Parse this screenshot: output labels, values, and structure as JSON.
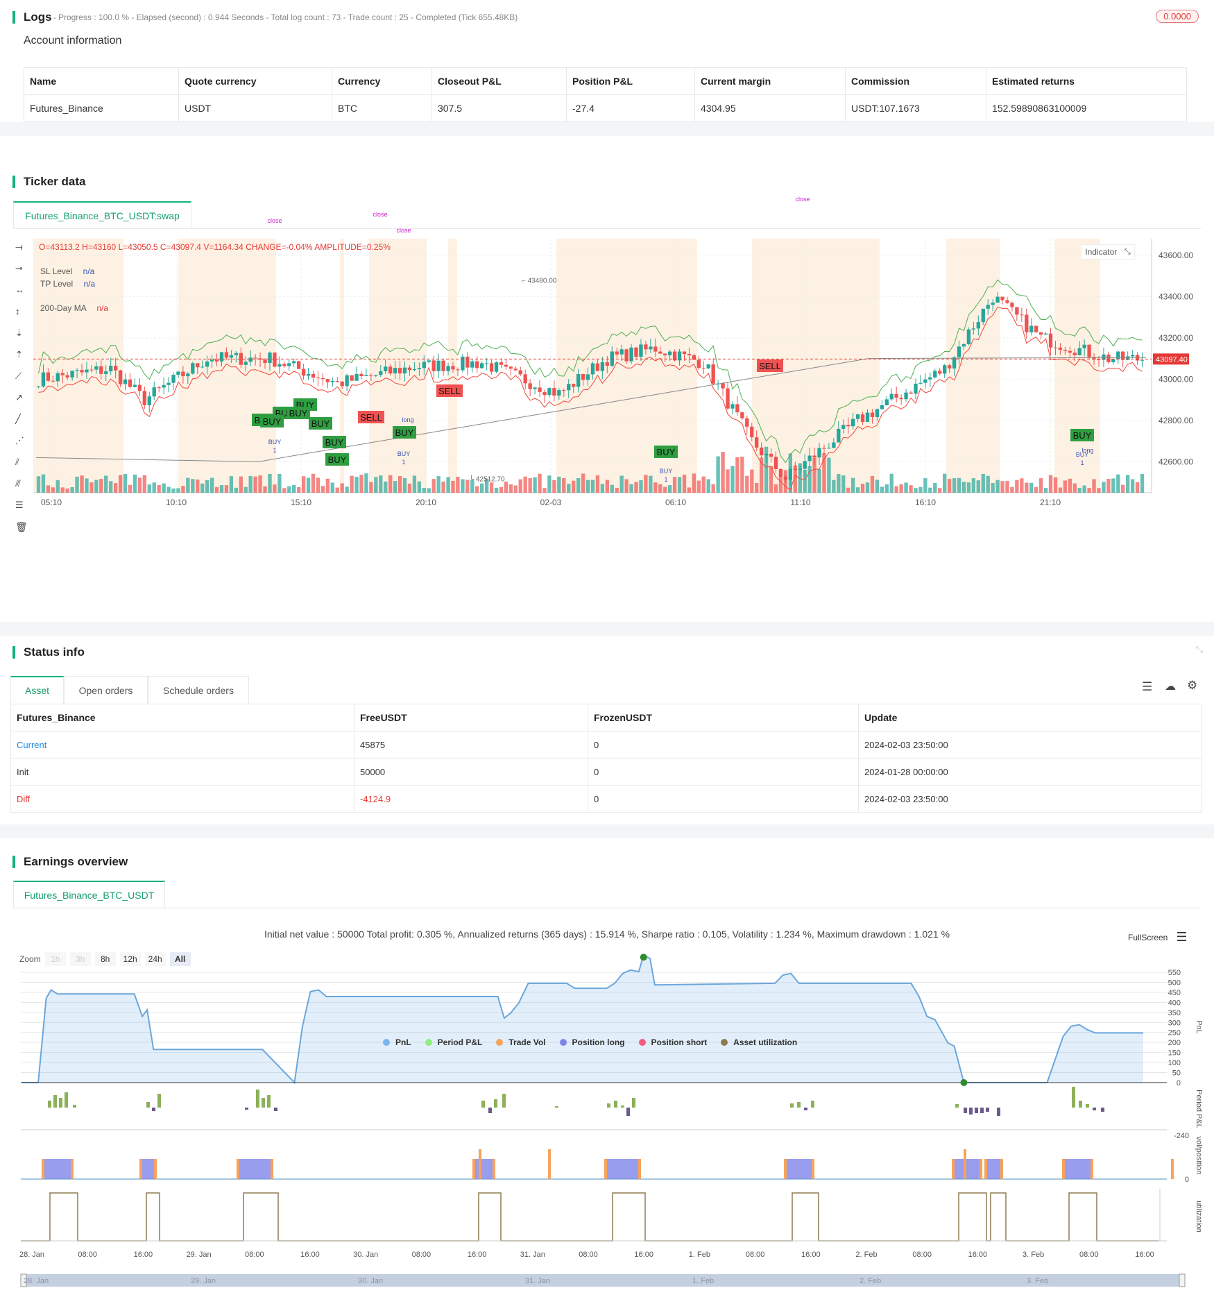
{
  "logs": {
    "title": "Logs",
    "progress_text": "- Progress : 100.0 % - Elapsed (second) : 0.944  Seconds - Total log count : 73 - Trade count : 25 - Completed (Tick 655.48KB)",
    "badge": "0.0000"
  },
  "account": {
    "title": "Account information",
    "headers": [
      "Name",
      "Quote currency",
      "Currency",
      "Closeout P&L",
      "Position P&L",
      "Current margin",
      "Commission",
      "Estimated returns"
    ],
    "row": [
      "Futures_Binance",
      "USDT",
      "BTC",
      "307.5",
      "-27.4",
      "4304.95",
      "USDT:107.1673",
      "152.59890863100009"
    ]
  },
  "ticker": {
    "title": "Ticker data",
    "tab": "Futures_Binance_BTC_USDT:swap",
    "ohlc": "O=43113.2 H=43160 L=43050.5 C=43097.4 V=1164.34 CHANGE=-0.04% AMPLITUDE=0.25%",
    "legend": [
      {
        "label": "SL Level",
        "value": "n/a"
      },
      {
        "label": "TP Level",
        "value": "n/a"
      },
      {
        "label": "200-Day MA",
        "value": "n/a"
      }
    ],
    "indicator_btn": "Indicator",
    "price_ticks": [
      "43600.00",
      "43400.00",
      "43200.00",
      "43000.00",
      "42800.00",
      "42600.00"
    ],
    "time_ticks": [
      "05:10",
      "10:10",
      "15:10",
      "20:10",
      "02-03",
      "06:10",
      "11:10",
      "16:10",
      "21:10"
    ],
    "current_price": "43097.40",
    "high_label": "43480.00",
    "low_label": "42512.70",
    "marker_buy": "BUY",
    "marker_sell": "SELL",
    "marker_close": "close",
    "marker_long": "long",
    "marker_one": "1",
    "colors": {
      "up": "#26a69a",
      "down": "#ef5350",
      "tp": "#4caf50",
      "sl": "#f44336",
      "ma": "#888888",
      "band": "#fdf1e3"
    }
  },
  "status": {
    "title": "Status info",
    "tabs": [
      "Asset",
      "Open orders",
      "Schedule orders"
    ],
    "headers": [
      "Futures_Binance",
      "FreeUSDT",
      "FrozenUSDT",
      "Update"
    ],
    "rows": [
      [
        "Current",
        "45875",
        "0",
        "2024-02-03 23:50:00"
      ],
      [
        "Init",
        "50000",
        "0",
        "2024-01-28 00:00:00"
      ],
      [
        "Diff",
        "-4124.9",
        "0",
        "2024-02-03 23:50:00"
      ]
    ]
  },
  "earnings": {
    "title": "Earnings overview",
    "tab": "Futures_Binance_BTC_USDT",
    "summary": "Initial net value : 50000  Total profit: 0.305 %, Annualized returns (365 days) : 15.914 %, Sharpe ratio : 0.105, Volatility : 1.234 %, Maximum drawdown : 1.021 %",
    "fullscreen": "FullScreen",
    "zoom_label": "Zoom",
    "zoom_buttons": [
      "1h",
      "3h",
      "8h",
      "12h",
      "24h",
      "All"
    ],
    "pnl_ticks": [
      "550",
      "500",
      "450",
      "400",
      "350",
      "300",
      "250",
      "200",
      "150",
      "100",
      "50",
      "0"
    ],
    "axis_labels": [
      "PnL",
      "Period P&L",
      "vol/position",
      "utilization"
    ],
    "period_low": "-240",
    "zero": "0",
    "date_ticks": [
      "28. Jan",
      "08:00",
      "16:00",
      "29. Jan",
      "08:00",
      "16:00",
      "30. Jan",
      "08:00",
      "16:00",
      "31. Jan",
      "08:00",
      "16:00",
      "1. Feb",
      "08:00",
      "16:00",
      "2. Feb",
      "08:00",
      "16:00",
      "3. Feb",
      "08:00",
      "16:00"
    ],
    "nav_ticks": [
      "28. Jan",
      "29. Jan",
      "30. Jan",
      "31. Jan",
      "1. Feb",
      "2. Feb",
      "3. Feb"
    ],
    "legend": [
      {
        "label": "PnL",
        "color": "#7cb5ec"
      },
      {
        "label": "Period P&L",
        "color": "#90ed7d"
      },
      {
        "label": "Trade Vol",
        "color": "#f7a35c"
      },
      {
        "label": "Position long",
        "color": "#8085e9"
      },
      {
        "label": "Position short",
        "color": "#f15c80"
      },
      {
        "label": "Asset utilization",
        "color": "#8d7b50"
      }
    ]
  }
}
